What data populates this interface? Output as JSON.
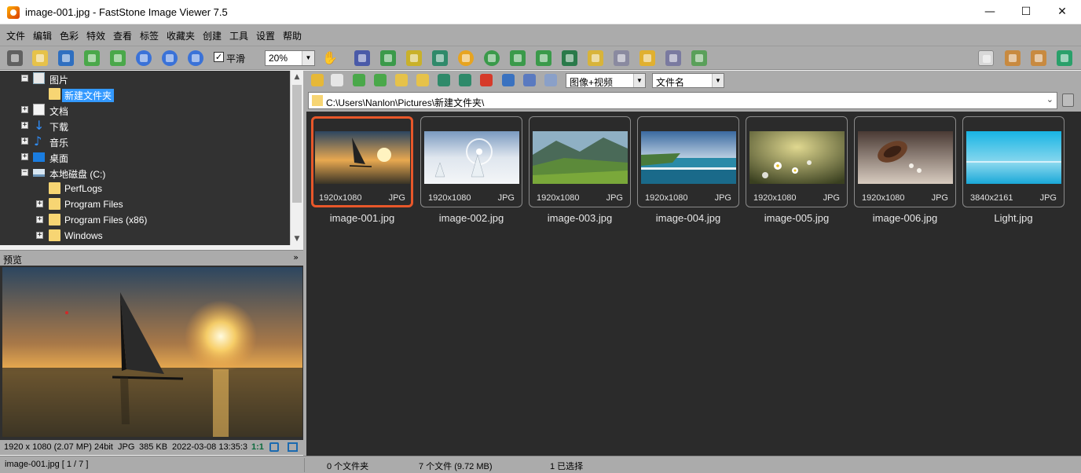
{
  "window": {
    "title": "image-001.jpg  -  FastStone Image Viewer 7.5",
    "minimize": "—",
    "maximize": "☐",
    "close": "✕"
  },
  "menu": [
    "文件",
    "编辑",
    "色彩",
    "特效",
    "查看",
    "标签",
    "收藏夹",
    "创建",
    "工具",
    "设置",
    "帮助"
  ],
  "toolbar": {
    "smooth_checked": "✓",
    "smooth_label": "平滑",
    "zoom_value": "20%",
    "hand_icon": "✋",
    "icons": [
      "camera-icon",
      "open-folder-icon",
      "save-icon",
      "back-icon",
      "forward-icon",
      "zoom-in-icon",
      "zoom-out-icon",
      "actual-size-icon",
      "slideshow-icon",
      "export-icon",
      "crop-icon",
      "convert-icon",
      "color-icon",
      "person-icon",
      "rotate-left-icon",
      "rotate-right-icon",
      "flip-icon",
      "resize-icon",
      "draw-icon",
      "email-icon",
      "print-icon",
      "batch-icon",
      "layout-browser-icon",
      "layout-preview-icon",
      "layout-fullpreview-icon",
      "fullscreen-icon"
    ]
  },
  "tree": {
    "items": [
      {
        "label": "图片",
        "icon": "pictures-icon",
        "expand": "−"
      },
      {
        "label": "新建文件夹",
        "icon": "folder-icon",
        "expand": ""
      },
      {
        "label": "文档",
        "icon": "documents-icon",
        "expand": "+"
      },
      {
        "label": "下载",
        "icon": "download-icon",
        "expand": "+"
      },
      {
        "label": "音乐",
        "icon": "music-icon",
        "expand": "+"
      },
      {
        "label": "桌面",
        "icon": "desktop-icon",
        "expand": "+"
      },
      {
        "label": "本地磁盘 (C:)",
        "icon": "drive-icon",
        "expand": "−"
      },
      {
        "label": "PerfLogs",
        "icon": "folder-icon",
        "expand": ""
      },
      {
        "label": "Program Files",
        "icon": "folder-icon",
        "expand": "+"
      },
      {
        "label": "Program Files (x86)",
        "icon": "folder-icon",
        "expand": "+"
      },
      {
        "label": "Windows",
        "icon": "folder-icon",
        "expand": "+"
      }
    ],
    "down_glyph": "↓",
    "music_glyph": "♪",
    "scroll_up": "▲",
    "scroll_down": "▼"
  },
  "preview": {
    "title": "预览",
    "collapse": "»",
    "info": {
      "dimensions": "1920 x 1080 (2.07 MP)",
      "bit": "24bit",
      "format": "JPG",
      "size": "385 KB",
      "datetime": "2022-03-08 13:35:3",
      "ratio": "1:1"
    }
  },
  "nav": {
    "filter": "图像+视频",
    "sort": "文件名",
    "arrow": "▼"
  },
  "address": {
    "path": "C:\\Users\\Nanlon\\Pictures\\新建文件夹\\",
    "drop": "⌄"
  },
  "thumbnails": [
    {
      "name": "image-001.jpg",
      "res": "1920x1080",
      "fmt": "JPG",
      "selected": true
    },
    {
      "name": "image-002.jpg",
      "res": "1920x1080",
      "fmt": "JPG",
      "selected": false
    },
    {
      "name": "image-003.jpg",
      "res": "1920x1080",
      "fmt": "JPG",
      "selected": false
    },
    {
      "name": "image-004.jpg",
      "res": "1920x1080",
      "fmt": "JPG",
      "selected": false
    },
    {
      "name": "image-005.jpg",
      "res": "1920x1080",
      "fmt": "JPG",
      "selected": false
    },
    {
      "name": "image-006.jpg",
      "res": "1920x1080",
      "fmt": "JPG",
      "selected": false
    },
    {
      "name": "Light.jpg",
      "res": "3840x2161",
      "fmt": "JPG",
      "selected": false
    }
  ],
  "status": {
    "current": "image-001.jpg [ 1 / 7 ]",
    "folders": "0 个文件夹",
    "files": "7 个文件 (9.72 MB)",
    "selected": "1 已选择"
  },
  "colors": {
    "selection_border": "#e8572a",
    "tree_highlight": "#3399ff",
    "panel_gray": "#ababab",
    "dark_bg": "#2b2b2b"
  }
}
